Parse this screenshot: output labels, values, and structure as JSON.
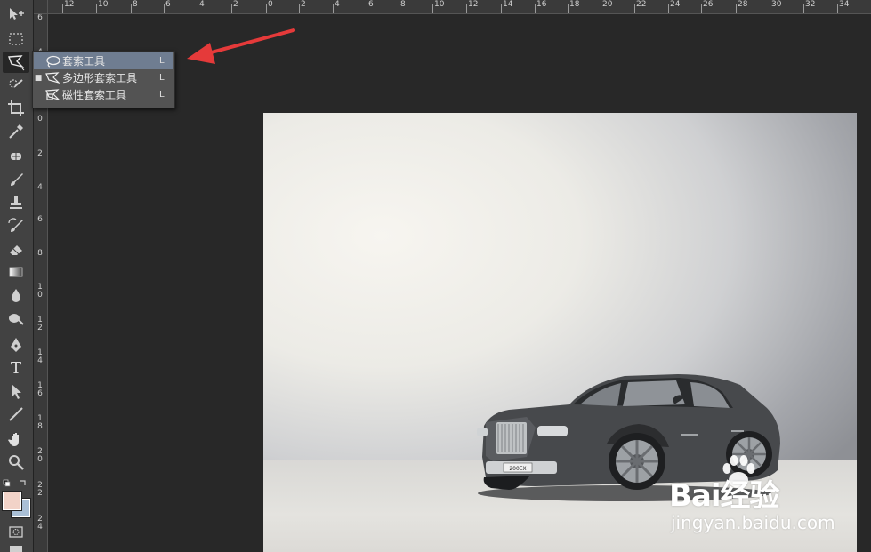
{
  "ruler_top": {
    "labels": [
      "12",
      "10",
      "8",
      "6",
      "4",
      "2",
      "0",
      "2",
      "4",
      "6",
      "8",
      "10",
      "12",
      "14",
      "16",
      "18",
      "20",
      "22",
      "24",
      "26",
      "28",
      "30",
      "32",
      "34"
    ]
  },
  "ruler_left": {
    "labels": [
      "6",
      "4",
      "2",
      "0",
      "2",
      "4",
      "6",
      "8",
      "10",
      "12",
      "14",
      "16",
      "18",
      "20",
      "22",
      "24"
    ]
  },
  "flyout": {
    "items": [
      {
        "label": "套索工具",
        "key": "L",
        "icon": "lasso-icon",
        "highlighted": true,
        "current": false
      },
      {
        "label": "多边形套索工具",
        "key": "L",
        "icon": "polygonal-lasso-icon",
        "highlighted": false,
        "current": true
      },
      {
        "label": "磁性套索工具",
        "key": "L",
        "icon": "magnetic-lasso-icon",
        "highlighted": false,
        "current": false
      }
    ],
    "current_bullet": "■"
  },
  "tools": [
    "move-tool",
    "rect-marquee-tool",
    "polygonal-lasso-tool",
    "quick-select-tool",
    "crop-tool",
    "eyedropper-tool",
    "healing-brush-tool",
    "brush-tool",
    "clone-stamp-tool",
    "history-brush-tool",
    "eraser-tool",
    "gradient-tool",
    "blur-tool",
    "dodge-tool",
    "pen-tool",
    "type-tool",
    "path-select-tool",
    "line-tool",
    "hand-tool",
    "zoom-tool"
  ],
  "text_tool_glyph": "T",
  "colors": {
    "foreground": "#f2d3c8",
    "background": "#a9bfd6",
    "arrow": "#e53a3a",
    "flyout_highlight": "#6f7d91"
  },
  "canvas": {
    "license_plate": "200EX"
  },
  "watermark": {
    "brand": "Bai经验",
    "url": "jingyan.baidu.com"
  }
}
